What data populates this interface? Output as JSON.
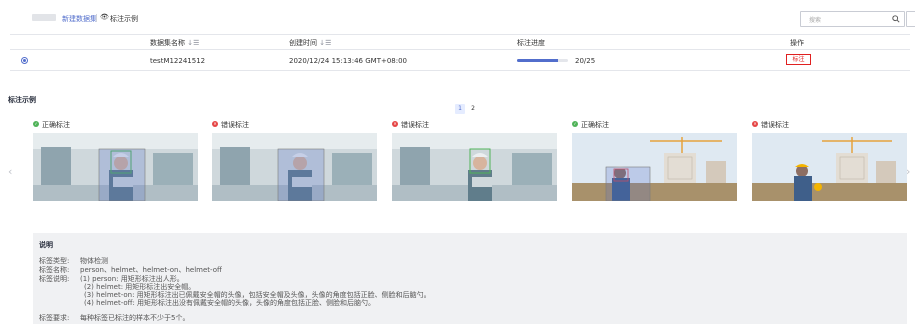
{
  "toolbar": {
    "new_dataset_label": "新建数据集",
    "example_label": "标注示例",
    "search_placeholder": "搜索"
  },
  "table": {
    "headers": [
      "数据集名称",
      "创建时间",
      "标注进度",
      "操作"
    ],
    "row": {
      "name": "testM12241512",
      "created": "2020/12/24 15:13:46 GMT+08:00",
      "progress_text": "20/25",
      "progress_fraction": 0.8,
      "action_label": "标注"
    }
  },
  "examples": {
    "section_title": "标注示例",
    "pages": [
      "1",
      "2"
    ],
    "current_page": "1",
    "cards": [
      {
        "status": "ok",
        "label": "正确标注",
        "scene": "lab"
      },
      {
        "status": "bad",
        "label": "错误标注",
        "scene": "lab"
      },
      {
        "status": "bad",
        "label": "错误标注",
        "scene": "lab"
      },
      {
        "status": "ok",
        "label": "正确标注",
        "scene": "site"
      },
      {
        "status": "bad",
        "label": "错误标注",
        "scene": "site"
      }
    ]
  },
  "description": {
    "title": "说明",
    "rows": [
      {
        "label": "标签类型:",
        "lines": [
          "物体检测"
        ]
      },
      {
        "label": "标签名称:",
        "lines": [
          "person、helmet、helmet-on、helmet-off"
        ]
      },
      {
        "label": "标签说明:",
        "lines": [
          "(1) person: 用矩形标注出人形。",
          "(2) helmet: 用矩形标注出安全帽。",
          "(3) helmet-on: 用矩形标注出已佩戴安全帽的头像，包括安全帽及头像，头像的角度包括正脸、侧脸和后脑勺。",
          "(4) helmet-off: 用矩形标注出没有佩戴安全帽的头像，头像的角度包括正脸、侧脸和后脑勺。"
        ]
      },
      {
        "label": "标签要求:",
        "lines": [
          "每种标签已标注的样本不少于5个。"
        ]
      }
    ]
  },
  "colors": {
    "accent": "#526ecc",
    "ok": "#50b359",
    "bad": "#e54545",
    "action_border": "#e02020"
  }
}
